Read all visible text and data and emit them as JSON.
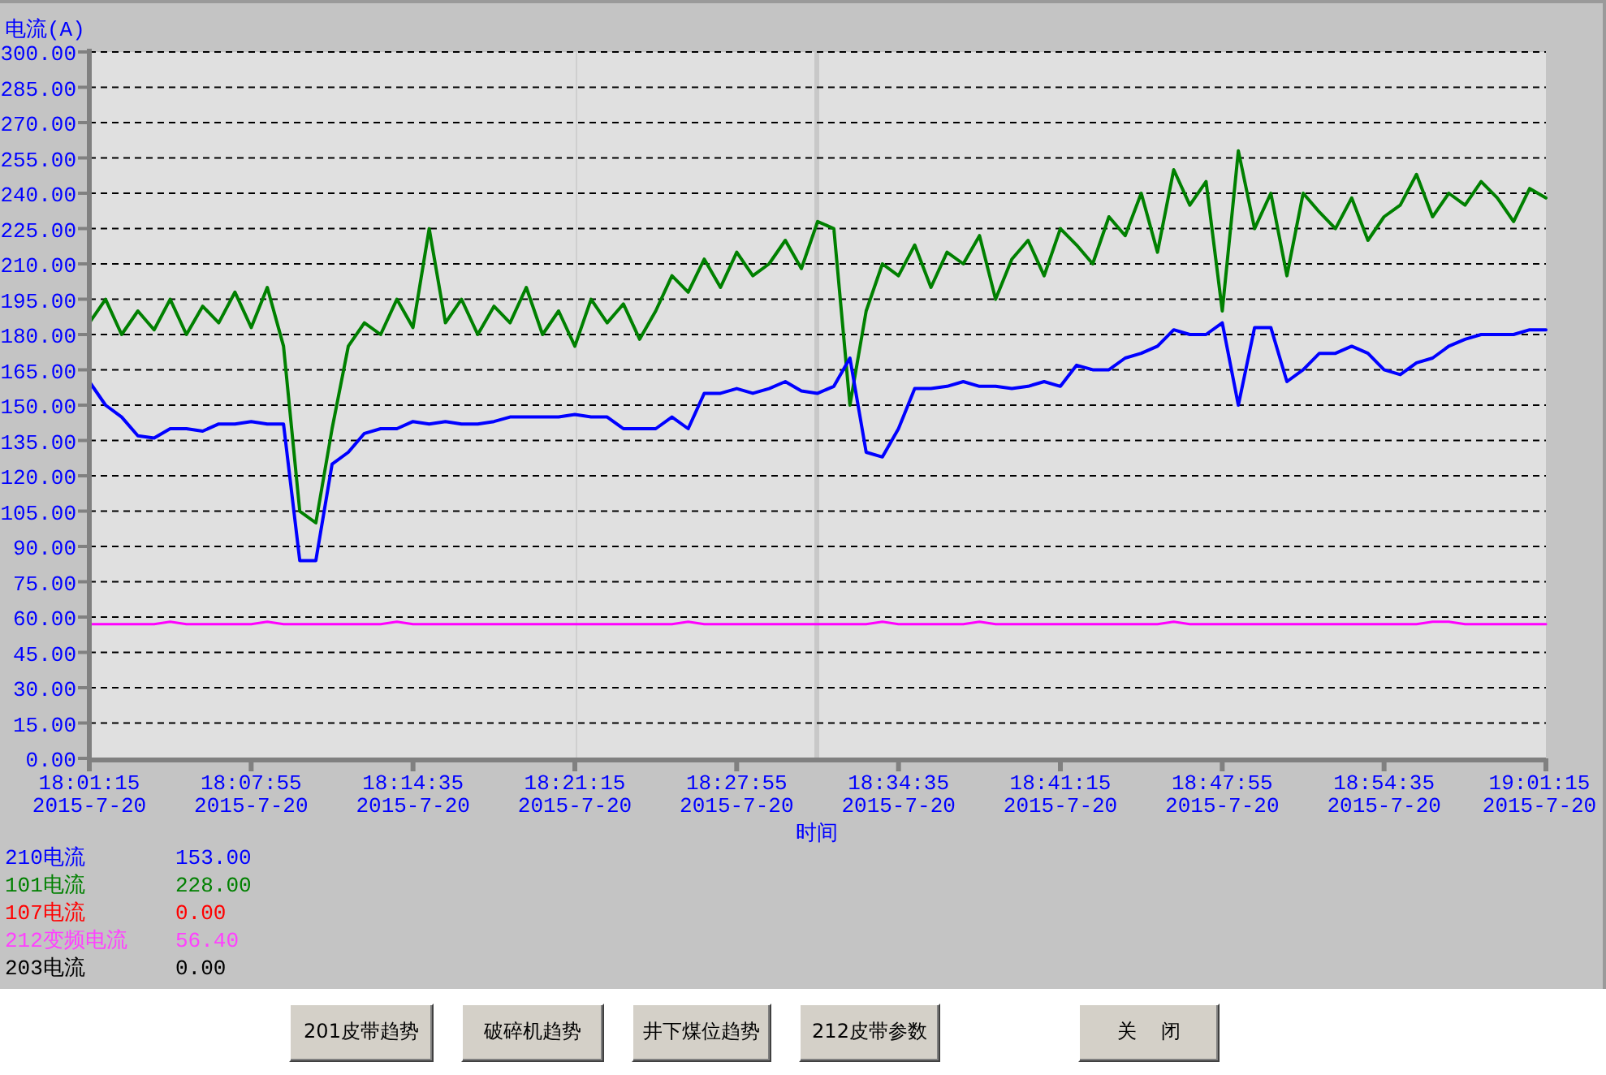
{
  "chart": {
    "chart_data": {
      "type": "line",
      "grid": true,
      "ylabel": "电流(A)",
      "xlabel": "时间",
      "ylim": [
        0,
        300
      ],
      "categories": [
        "18:01:15\n2015-7-20",
        null,
        null,
        null,
        null,
        null,
        null,
        null,
        null,
        null,
        "18:07:55\n2015-7-20",
        null,
        null,
        null,
        null,
        null,
        null,
        null,
        null,
        null,
        "18:14:35\n2015-7-20",
        null,
        null,
        null,
        null,
        null,
        null,
        null,
        null,
        null,
        "18:21:15\n2015-7-20",
        null,
        null,
        null,
        null,
        null,
        null,
        null,
        null,
        null,
        "18:27:55\n2015-7-20",
        null,
        null,
        null,
        null,
        null,
        null,
        null,
        null,
        null,
        "18:34:35\n2015-7-20",
        null,
        null,
        null,
        null,
        null,
        null,
        null,
        null,
        null,
        "18:41:15\n2015-7-20",
        null,
        null,
        null,
        null,
        null,
        null,
        null,
        null,
        null,
        "18:47:55\n2015-7-20",
        null,
        null,
        null,
        null,
        null,
        null,
        null,
        null,
        null,
        "18:54:35\n2015-7-20",
        null,
        null,
        null,
        null,
        null,
        null,
        null,
        null,
        null,
        "19:01:15\n2015-7-20"
      ],
      "yticks": [
        {
          "value": 0,
          "label": "0.00"
        },
        {
          "value": 15,
          "label": "15.00"
        },
        {
          "value": 30,
          "label": "30.00"
        },
        {
          "value": 45,
          "label": "45.00"
        },
        {
          "value": 60,
          "label": "60.00"
        },
        {
          "value": 75,
          "label": "75.00"
        },
        {
          "value": 90,
          "label": "90.00"
        },
        {
          "value": 105,
          "label": "105.00"
        },
        {
          "value": 120,
          "label": "120.00"
        },
        {
          "value": 135,
          "label": "135.00"
        },
        {
          "value": 150,
          "label": "150.00"
        },
        {
          "value": 165,
          "label": "165.00"
        },
        {
          "value": 180,
          "label": "180.00"
        },
        {
          "value": 195,
          "label": "195.00"
        },
        {
          "value": 210,
          "label": "210.00"
        },
        {
          "value": 225,
          "label": "225.00"
        },
        {
          "value": 240,
          "label": "240.00"
        },
        {
          "value": 255,
          "label": "255.00"
        },
        {
          "value": 270,
          "label": "270.00"
        },
        {
          "value": 285,
          "label": "285.00"
        },
        {
          "value": 300,
          "label": "300.00"
        }
      ],
      "series": [
        {
          "color": "#008000",
          "values": [
            185,
            195,
            180,
            190,
            182,
            195,
            180,
            192,
            185,
            198,
            183,
            200,
            175,
            105,
            100,
            140,
            175,
            185,
            180,
            195,
            183,
            225,
            185,
            195,
            180,
            192,
            185,
            200,
            180,
            190,
            175,
            195,
            185,
            193,
            178,
            190,
            205,
            198,
            212,
            200,
            215,
            205,
            210,
            220,
            208,
            228,
            225,
            150,
            190,
            210,
            205,
            218,
            200,
            215,
            210,
            222,
            195,
            212,
            220,
            205,
            225,
            218,
            210,
            230,
            222,
            240,
            215,
            250,
            235,
            245,
            190,
            258,
            225,
            240,
            205,
            240,
            232,
            225,
            238,
            220,
            230,
            235,
            248,
            230,
            240,
            235,
            245,
            238,
            228,
            242,
            238
          ]
        },
        {
          "color": "#0000ff",
          "values": [
            160,
            150,
            145,
            137,
            136,
            140,
            140,
            139,
            142,
            142,
            143,
            142,
            142,
            84,
            84,
            125,
            130,
            138,
            140,
            140,
            143,
            142,
            143,
            142,
            142,
            143,
            145,
            145,
            145,
            145,
            146,
            145,
            145,
            140,
            140,
            140,
            145,
            140,
            155,
            155,
            157,
            155,
            157,
            160,
            156,
            155,
            158,
            170,
            130,
            128,
            140,
            157,
            157,
            158,
            160,
            158,
            158,
            157,
            158,
            160,
            158,
            167,
            165,
            165,
            170,
            172,
            175,
            182,
            180,
            180,
            185,
            150,
            183,
            183,
            160,
            165,
            172,
            172,
            175,
            172,
            165,
            163,
            168,
            170,
            175,
            178,
            180,
            180,
            180,
            182,
            182
          ]
        },
        {
          "color": "#ff00ff",
          "values": [
            57,
            57,
            57,
            57,
            57,
            58,
            57,
            57,
            57,
            57,
            57,
            58,
            57,
            57,
            57,
            57,
            57,
            57,
            57,
            58,
            57,
            57,
            57,
            57,
            57,
            57,
            57,
            57,
            57,
            57,
            57,
            57,
            57,
            57,
            57,
            57,
            57,
            58,
            57,
            57,
            57,
            57,
            57,
            57,
            57,
            57,
            57,
            57,
            57,
            58,
            57,
            57,
            57,
            57,
            57,
            58,
            57,
            57,
            57,
            57,
            57,
            57,
            57,
            57,
            57,
            57,
            57,
            58,
            57,
            57,
            57,
            57,
            57,
            57,
            57,
            57,
            57,
            57,
            57,
            57,
            57,
            57,
            57,
            58,
            58,
            57,
            57,
            57,
            57,
            57,
            57
          ]
        }
      ]
    }
  },
  "legend": [
    {
      "name": "210电流",
      "value": "153.00",
      "color": "#0000ff"
    },
    {
      "name": "101电流",
      "value": "228.00",
      "color": "#008000"
    },
    {
      "name": "107电流",
      "value": "0.00",
      "color": "#ff0000"
    },
    {
      "name": "212变频电流",
      "value": "56.40",
      "color": "#ff40ff"
    },
    {
      "name": "203电流",
      "value": "0.00",
      "color": "#000000"
    }
  ],
  "buttons": [
    {
      "label": "201皮带趋势"
    },
    {
      "label": "破碎机趋势"
    },
    {
      "label": "井下煤位趋势"
    },
    {
      "label": "212皮带参数"
    },
    {
      "label": "关    闭"
    }
  ]
}
